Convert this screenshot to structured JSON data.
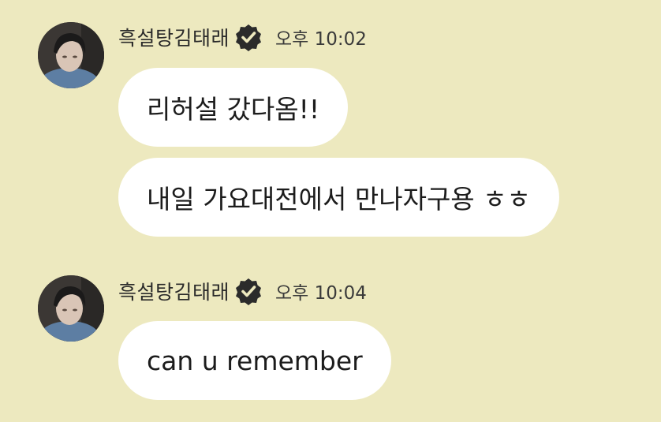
{
  "colors": {
    "background": "#ede9bf",
    "bubble": "#ffffff",
    "badge": "#2b2b2b"
  },
  "messages": [
    {
      "sender": "흑설탕김태래",
      "verified_icon": "verified-badge-icon",
      "time": "오후 10:02",
      "bubbles": [
        "리허설 갔다옴!!",
        "내일 가요대전에서 만나자구용 ㅎㅎ"
      ]
    },
    {
      "sender": "흑설탕김태래",
      "verified_icon": "verified-badge-icon",
      "time": "오후 10:04",
      "bubbles": [
        "can u remember"
      ]
    }
  ]
}
